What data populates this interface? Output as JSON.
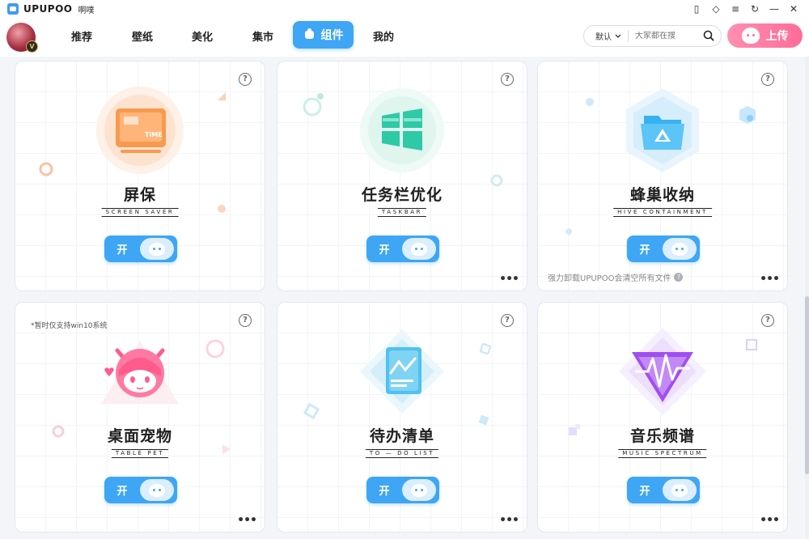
{
  "app": {
    "brand": "UPUPOO",
    "subtitle": "啊噗"
  },
  "window_controls": [
    {
      "name": "mobile-icon",
      "glyph": "▯"
    },
    {
      "name": "skin-icon",
      "glyph": "◇"
    },
    {
      "name": "menu-icon",
      "glyph": "≡"
    },
    {
      "name": "refresh-icon",
      "glyph": "↻"
    },
    {
      "name": "minimize-icon",
      "glyph": "—"
    },
    {
      "name": "close-icon",
      "glyph": "✕"
    }
  ],
  "avatar": {
    "badge": "V"
  },
  "nav": {
    "items": [
      "推荐",
      "壁纸",
      "美化",
      "集市",
      "组件",
      "我的"
    ],
    "active": "组件"
  },
  "search": {
    "sort_label": "默认",
    "placeholder": "大家都在搜"
  },
  "upload": {
    "label": "上传"
  },
  "cards": [
    {
      "title": "屏保",
      "subtitle": "SCREEN SAVER",
      "toggle": "开",
      "icon": "screen-saver-icon"
    },
    {
      "title": "任务栏优化",
      "subtitle": "TASKBAR",
      "toggle": "开",
      "icon": "taskbar-icon"
    },
    {
      "title": "蜂巢收纳",
      "subtitle": "HIVE CONTAINMENT",
      "toggle": "开",
      "icon": "hive-folder-icon",
      "footnote": "强力卸载UPUPOO会清空所有文件"
    },
    {
      "title": "桌面宠物",
      "subtitle": "TABLE PET",
      "toggle": "开",
      "icon": "desktop-pet-icon",
      "note": "*暂时仅支持win10系统"
    },
    {
      "title": "待办清单",
      "subtitle": "TO — DO LIST",
      "toggle": "开",
      "icon": "todo-list-icon"
    },
    {
      "title": "音乐频谱",
      "subtitle": "MUSIC SPECTRUM",
      "toggle": "开",
      "icon": "music-spectrum-icon"
    }
  ],
  "colors": {
    "accent": "#3ea6f4",
    "upload": "#ff6c9a",
    "screen_saver": "#f7a15f",
    "taskbar": "#2ec9a7",
    "hive": "#35b2f2",
    "pet": "#ff5b8d",
    "todo": "#51c1ef",
    "music": "#a04ef0"
  }
}
